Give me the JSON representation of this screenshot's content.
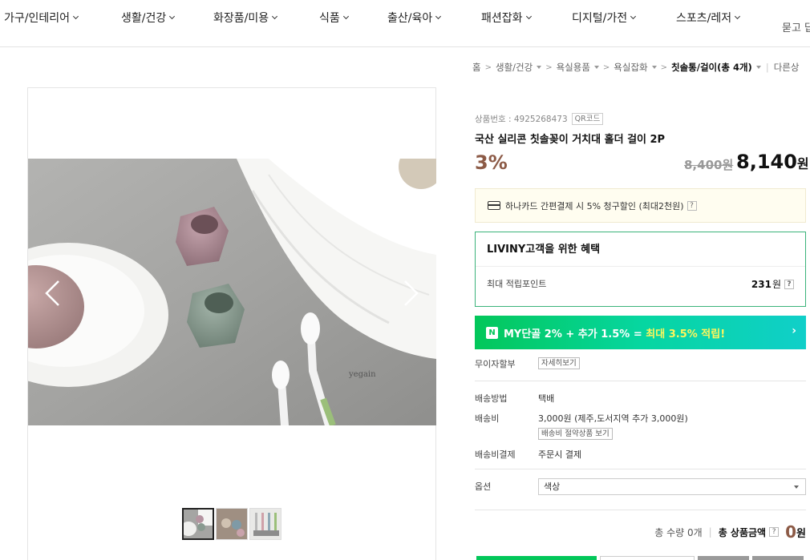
{
  "nav": {
    "categories": [
      "가구/인테리어",
      "생활/건강",
      "화장품/미용",
      "식품",
      "출산/육아",
      "패션잡화",
      "디지털/가전",
      "스포츠/레저"
    ],
    "ask": "묻고 답"
  },
  "breadcrumb": {
    "items": [
      "홈",
      "생활/건강",
      "욕실용품",
      "욕실잡화"
    ],
    "current": "칫솔통/걸이",
    "count_label": "(총 4개)",
    "other": "다른상"
  },
  "gallery": {
    "watermark": "yegain",
    "thumb_count": 3
  },
  "product": {
    "number_label": "상품번호 : 4925268473",
    "qr_label": "QR코드",
    "title": "국산 실리콘 칫솔꽂이 거치대 홀더 걸이 2P",
    "discount": "3%",
    "original_price": "8,400원",
    "price": "8,140",
    "price_unit": "원"
  },
  "card_promo": {
    "text": "하나카드 간편결제 시 5% 청구할인 (최대2천원)",
    "help": "?"
  },
  "benefit": {
    "header": "LIVINY고객을 위한 혜택",
    "row_label": "최대 적립포인트",
    "points": "231",
    "points_unit": "원",
    "help": "?"
  },
  "npay": {
    "logo": "N",
    "prefix": "MY단골 2% + 추가 1.5% = ",
    "highlight": "최대 3.5% 적립!",
    "arrow": "›"
  },
  "installment": {
    "label": "무이자할부",
    "button": "자세히보기"
  },
  "shipping": {
    "method_label": "배송방법",
    "method_value": "택배",
    "fee_label": "배송비",
    "fee_value": "3,000원 (제주,도서지역 추가 3,000원)",
    "fee_button": "배송비 절약상품 보기",
    "pay_label": "배송비결제",
    "pay_value": "주문시 결제"
  },
  "option": {
    "label": "옵션",
    "selected": "색상"
  },
  "total": {
    "qty_label": "총 수량",
    "qty_value": "0개",
    "amount_label": "총 상품금액",
    "help": "?",
    "amount": "0",
    "unit": "원"
  },
  "colors": {
    "accent_brown": "#8c5a46",
    "naver_green": "#03c75a",
    "benefit_border": "#3bb37a"
  }
}
